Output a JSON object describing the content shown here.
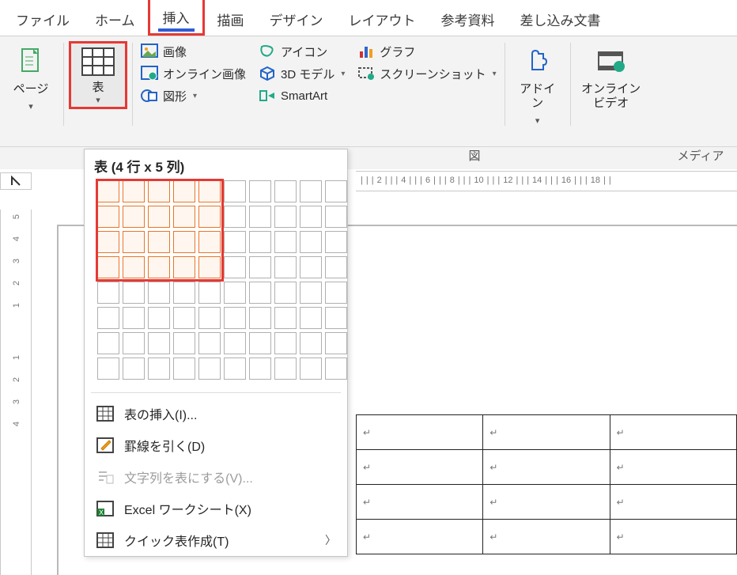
{
  "tabs": {
    "file": "ファイル",
    "home": "ホーム",
    "insert": "挿入",
    "draw": "描画",
    "design": "デザイン",
    "layout": "レイアウト",
    "references": "参考資料",
    "mailings": "差し込み文書"
  },
  "ribbon": {
    "pages_label": "ページ",
    "table_label": "表",
    "illustrations": {
      "image": "画像",
      "online_image": "オンライン画像",
      "shapes": "図形",
      "icons": "アイコン",
      "models3d": "3D モデル",
      "smartart": "SmartArt",
      "chart": "グラフ",
      "screenshot": "スクリーンショット"
    },
    "addins_label": "アドイ\nン",
    "online_video_label": "オンライン\nビデオ",
    "group_figure": "図",
    "group_media": "メディア"
  },
  "dropdown": {
    "title": "表 (4 行 x 5 列)",
    "sel_rows": 4,
    "sel_cols": 5,
    "insert_table": "表の挿入(I)...",
    "draw_table": "罫線を引く(D)",
    "text_to_table": "文字列を表にする(V)...",
    "excel": "Excel ワークシート(X)",
    "quick_tables": "クイック表作成(T)"
  },
  "ruler": {
    "h_marks": [
      "|",
      "|",
      "|",
      "2",
      "|",
      "|",
      "|",
      "4",
      "|",
      "|",
      "|",
      "6",
      "|",
      "|",
      "|",
      "8",
      "|",
      "|",
      "|",
      "10",
      "|",
      "|",
      "|",
      "12",
      "|",
      "|",
      "|",
      "14",
      "|",
      "|",
      "|",
      "16",
      "|",
      "|",
      "|",
      "18",
      "|",
      "|"
    ],
    "v_marks_top": [
      "5",
      "4",
      "3",
      "2",
      "1"
    ],
    "v_marks_bottom": [
      "1",
      "2",
      "3",
      "4"
    ]
  },
  "doc": {
    "table_rows": 4,
    "table_cols": 3,
    "cell_mark": "↵"
  }
}
